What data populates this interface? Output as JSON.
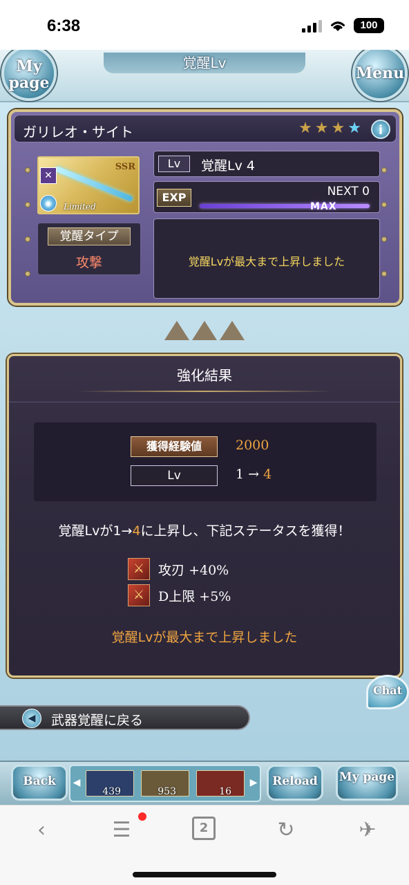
{
  "status_bar": {
    "time": "6:38",
    "battery": "100"
  },
  "header": {
    "title": "覚醒Lv",
    "mypage_button": "My page",
    "menu_button": "Menu"
  },
  "weapon_card": {
    "name": "ガリレオ・サイト",
    "rarity_badge": "SSR",
    "limited_label": "Limited",
    "awaken_type_label": "覚醒タイプ",
    "awaken_type_value": "攻撃",
    "lv_tag": "Lv",
    "lv_value": "覚醒Lv 4",
    "exp_tag": "EXP",
    "next_label": "NEXT 0",
    "exp_bar_label": "MAX",
    "exp_progress": 1.0,
    "message": "覚醒Lvが最大まで上昇しました"
  },
  "result": {
    "title": "強化結果",
    "exp_gain_label": "獲得経験値",
    "exp_gain_value": "2000",
    "lv_label": "Lv",
    "lv_from": "1",
    "lv_arrow": "→",
    "lv_to": "4",
    "summary_prefix": "覚醒Lvが",
    "summary_from": "1",
    "summary_arrow": "→",
    "summary_to": "4",
    "summary_suffix": "に上昇し、下記ステータスを獲得！",
    "stats": [
      {
        "name": "攻刃",
        "value": "+40%"
      },
      {
        "name": "D上限",
        "value": "+5%"
      }
    ],
    "footer": "覚醒Lvが最大まで上昇しました"
  },
  "chat_button": "Chat",
  "back_link": "武器覚醒に戻る",
  "bottom_nav": {
    "back": "Back",
    "reload": "Reload",
    "mypage": "My page",
    "items": [
      {
        "name": "crystal-item",
        "count": "439",
        "color": "#2b3f6a"
      },
      {
        "name": "ticket-item",
        "count": "953",
        "color": "#6a5a3a"
      },
      {
        "name": "scroll-item",
        "count": "16",
        "color": "#7a2a22"
      }
    ]
  },
  "browser": {
    "tab_count": "2"
  },
  "colors": {
    "accent_gold": "#d9c48a",
    "highlight_orange": "#f0a540",
    "message_yellow": "#f4d660"
  }
}
